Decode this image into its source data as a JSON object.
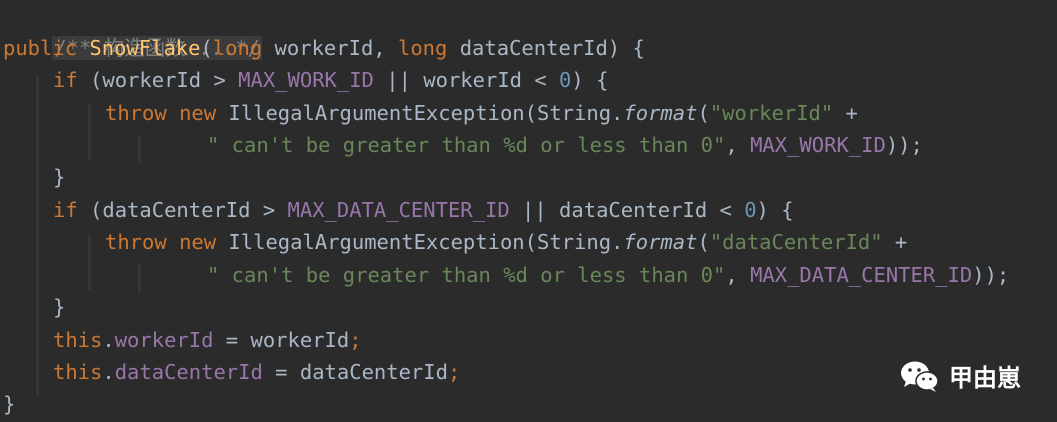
{
  "code": {
    "comment": "/** 构造函数 ...*/",
    "l2": {
      "kw_public": "public",
      "method_name": "SnowFlake",
      "open_paren": "(",
      "kw_long1": "long",
      "param1": " workerId, ",
      "kw_long2": "long",
      "param2": " dataCenterId) {"
    },
    "l3": {
      "kw_if": "if",
      "p1": " (workerId > ",
      "const1": "MAX_WORK_ID",
      "p2": " || workerId < ",
      "num": "0",
      "p3": ") {"
    },
    "l4": {
      "kw_throw": "throw",
      "kw_new": "new",
      "p1": " IllegalArgumentException(String.",
      "method": "format",
      "p2": "(",
      "str": "\"workerId\"",
      "p3": " +"
    },
    "l5": {
      "str": "\" can't be greater than %d or less than 0\"",
      "p1": ", ",
      "const": "MAX_WORK_ID",
      "p2": "));"
    },
    "l6": {
      "brace": "}"
    },
    "l7": {
      "kw_if": "if",
      "p1": " (dataCenterId > ",
      "const1": "MAX_DATA_CENTER_ID",
      "p2": " || dataCenterId < ",
      "num": "0",
      "p3": ") {"
    },
    "l8": {
      "kw_throw": "throw",
      "kw_new": "new",
      "p1": " IllegalArgumentException(String.",
      "method": "format",
      "p2": "(",
      "str": "\"dataCenterId\"",
      "p3": " +"
    },
    "l9": {
      "str": "\" can't be greater than %d or less than 0\"",
      "p1": ", ",
      "const": "MAX_DATA_CENTER_ID",
      "p2": "));"
    },
    "l10": {
      "brace": "}"
    },
    "l11": {
      "kw_this": "this",
      "dot": ".",
      "field": "workerId",
      "p1": " = workerId",
      "semi": ";"
    },
    "l12": {
      "kw_this": "this",
      "dot": ".",
      "field": "dataCenterId",
      "p1": " = dataCenterId",
      "semi": ";"
    },
    "l13": {
      "brace": "}"
    }
  },
  "watermark": {
    "text": "甲由崽",
    "icon": "wechat-icon"
  },
  "colors": {
    "background": "#2b2b2b",
    "keyword": "#cc7832",
    "method": "#ffc66d",
    "constant": "#9876aa",
    "number": "#6897bb",
    "string": "#6a8759",
    "text": "#a9b7c6",
    "comment": "#808080"
  }
}
